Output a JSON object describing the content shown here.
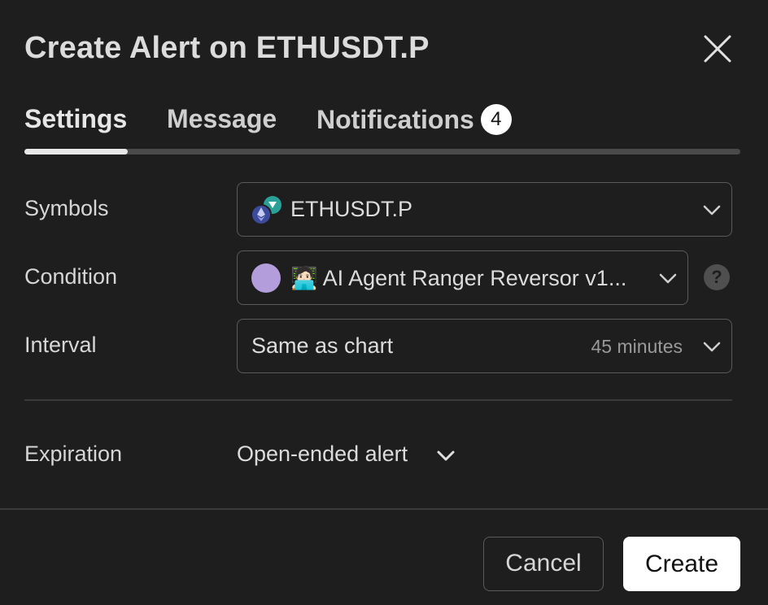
{
  "dialog": {
    "title": "Create Alert on ETHUSDT.P",
    "close_icon": "close-icon"
  },
  "tabs": [
    {
      "label": "Settings",
      "active": true
    },
    {
      "label": "Message",
      "active": false
    },
    {
      "label": "Notifications",
      "active": false,
      "badge": "4"
    }
  ],
  "form": {
    "symbols": {
      "label": "Symbols",
      "value": "ETHUSDT.P",
      "icon": "ethereum-icon"
    },
    "condition": {
      "label": "Condition",
      "value": "🧑🏻‍💻 AI Agent Ranger Reversor v1...",
      "color": "#b39ddb",
      "help_label": "?"
    },
    "interval": {
      "label": "Interval",
      "value": "Same as chart",
      "hint": "45 minutes"
    },
    "expiration": {
      "label": "Expiration",
      "value": "Open-ended alert"
    }
  },
  "footer": {
    "cancel_label": "Cancel",
    "create_label": "Create"
  },
  "colors": {
    "background": "#1e1e1e",
    "border": "#5a5a5a",
    "primary_button": "#ffffff",
    "condition_dot": "#b39ddb"
  }
}
